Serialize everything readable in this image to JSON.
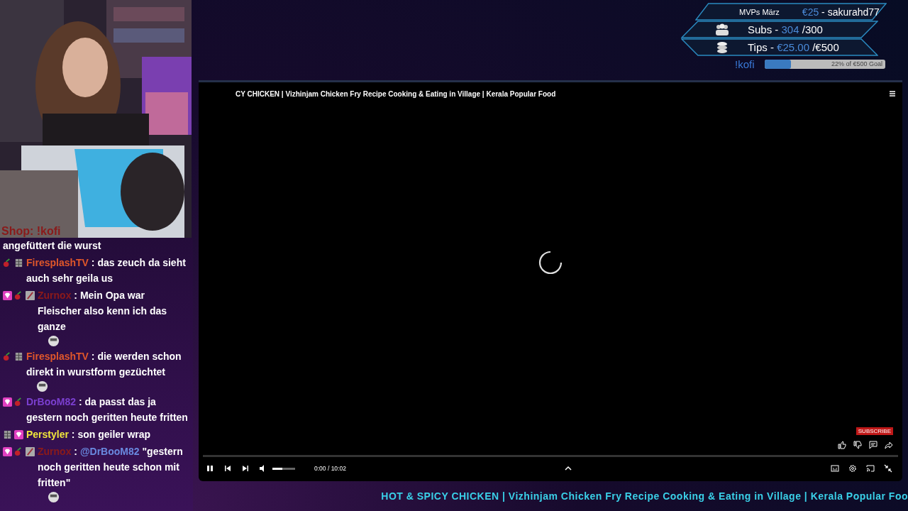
{
  "stats": {
    "mvp": {
      "label": "MVPs März",
      "amount": "€25",
      "name": "- sakurahd77"
    },
    "subs": {
      "label": "Subs -",
      "current": "304",
      "goal": "/300"
    },
    "tips": {
      "label": "Tips -",
      "current": "€25.00",
      "goal": "/€500"
    },
    "kofi": {
      "label": "!kofi",
      "level": 0.22,
      "goal_text": "22% of €500 Goal"
    }
  },
  "webcam": {
    "kind": "picture",
    "shop_label": "Shop: !kofi"
  },
  "chat": [
    {
      "parts": [
        {
          "text": "angefüttert die wurst"
        }
      ],
      "emote": false
    },
    {
      "user": "FiresplashTV",
      "separator": ":",
      "color": "#e0572a",
      "badges": [
        {
          "kind": "cherry"
        },
        {
          "kind": "grid"
        }
      ],
      "parts": [
        {
          "text": "das zeuch da sieht auch sehr geila us"
        }
      ],
      "emote": false
    },
    {
      "user": "Zurnox",
      "separator": ":",
      "color": "#8b1a1a",
      "badges": [
        {
          "kind": "gem"
        },
        {
          "kind": "cherry"
        },
        {
          "kind": "feather"
        }
      ],
      "parts": [
        {
          "text": "Mein Opa war Fleischer also kenn ich das ganze"
        }
      ],
      "emote": true
    },
    {
      "user": "FiresplashTV",
      "separator": ":",
      "color": "#e0572a",
      "badges": [
        {
          "kind": "cherry"
        },
        {
          "kind": "grid"
        }
      ],
      "parts": [
        {
          "text": "die werden schon direkt in wurstform gezüchtet"
        }
      ],
      "emote": true
    },
    {
      "user": "DrBooM82",
      "separator": ":",
      "color": "#7b3fd0",
      "badges": [
        {
          "kind": "gem"
        },
        {
          "kind": "cherry"
        }
      ],
      "parts": [
        {
          "text": "da passt das ja gestern noch geritten heute fritten"
        }
      ],
      "emote": false
    },
    {
      "user": "Perstyler",
      "separator": ":",
      "color": "#f0e63c",
      "badges": [
        {
          "kind": "grid"
        },
        {
          "kind": "gem"
        }
      ],
      "parts": [
        {
          "text": "son geiler wrap"
        }
      ],
      "emote": false
    },
    {
      "user": "Zurnox",
      "separator": ":",
      "color": "#8b1a1a",
      "badges": [
        {
          "kind": "gem"
        },
        {
          "kind": "cherry"
        },
        {
          "kind": "feather"
        }
      ],
      "parts": [
        {
          "text": "@DrBooM82",
          "mention": true
        },
        {
          "text": " \"gestern noch geritten heute schon mit fritten\""
        }
      ],
      "emote": true
    }
  ],
  "player": {
    "title": "CY CHICKEN | Vizhinjam Chicken Fry Recipe Cooking & Eating in Village | Kerala Popular Food",
    "loading": true,
    "playing": true,
    "volume": {
      "level": 0.45
    },
    "progress": {
      "level": 0
    },
    "time": "0:00 / 10:02",
    "subscribe": "SUBSCRIBE"
  },
  "ticker": "HOT & SPICY CHICKEN | Vizhinjam Chicken Fry Recipe Cooking & Eating in Village | Kerala Popular Foo"
}
